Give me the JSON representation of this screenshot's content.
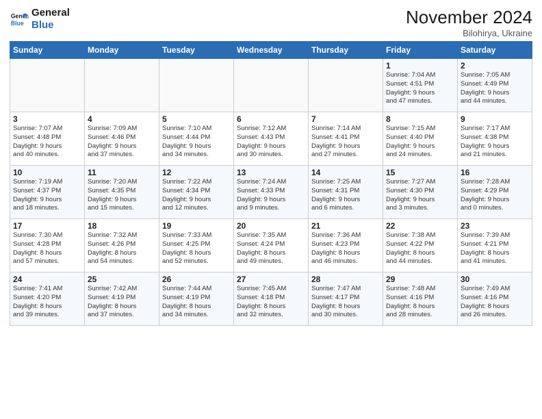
{
  "logo": {
    "line1": "General",
    "line2": "Blue"
  },
  "header": {
    "month": "November 2024",
    "location": "Bilohirya, Ukraine"
  },
  "weekdays": [
    "Sunday",
    "Monday",
    "Tuesday",
    "Wednesday",
    "Thursday",
    "Friday",
    "Saturday"
  ],
  "weeks": [
    [
      {
        "day": "",
        "info": ""
      },
      {
        "day": "",
        "info": ""
      },
      {
        "day": "",
        "info": ""
      },
      {
        "day": "",
        "info": ""
      },
      {
        "day": "",
        "info": ""
      },
      {
        "day": "1",
        "info": "Sunrise: 7:04 AM\nSunset: 4:51 PM\nDaylight: 9 hours\nand 47 minutes."
      },
      {
        "day": "2",
        "info": "Sunrise: 7:05 AM\nSunset: 4:49 PM\nDaylight: 9 hours\nand 44 minutes."
      }
    ],
    [
      {
        "day": "3",
        "info": "Sunrise: 7:07 AM\nSunset: 4:48 PM\nDaylight: 9 hours\nand 40 minutes."
      },
      {
        "day": "4",
        "info": "Sunrise: 7:09 AM\nSunset: 4:46 PM\nDaylight: 9 hours\nand 37 minutes."
      },
      {
        "day": "5",
        "info": "Sunrise: 7:10 AM\nSunset: 4:44 PM\nDaylight: 9 hours\nand 34 minutes."
      },
      {
        "day": "6",
        "info": "Sunrise: 7:12 AM\nSunset: 4:43 PM\nDaylight: 9 hours\nand 30 minutes."
      },
      {
        "day": "7",
        "info": "Sunrise: 7:14 AM\nSunset: 4:41 PM\nDaylight: 9 hours\nand 27 minutes."
      },
      {
        "day": "8",
        "info": "Sunrise: 7:15 AM\nSunset: 4:40 PM\nDaylight: 9 hours\nand 24 minutes."
      },
      {
        "day": "9",
        "info": "Sunrise: 7:17 AM\nSunset: 4:38 PM\nDaylight: 9 hours\nand 21 minutes."
      }
    ],
    [
      {
        "day": "10",
        "info": "Sunrise: 7:19 AM\nSunset: 4:37 PM\nDaylight: 9 hours\nand 18 minutes."
      },
      {
        "day": "11",
        "info": "Sunrise: 7:20 AM\nSunset: 4:35 PM\nDaylight: 9 hours\nand 15 minutes."
      },
      {
        "day": "12",
        "info": "Sunrise: 7:22 AM\nSunset: 4:34 PM\nDaylight: 9 hours\nand 12 minutes."
      },
      {
        "day": "13",
        "info": "Sunrise: 7:24 AM\nSunset: 4:33 PM\nDaylight: 9 hours\nand 9 minutes."
      },
      {
        "day": "14",
        "info": "Sunrise: 7:25 AM\nSunset: 4:31 PM\nDaylight: 9 hours\nand 6 minutes."
      },
      {
        "day": "15",
        "info": "Sunrise: 7:27 AM\nSunset: 4:30 PM\nDaylight: 9 hours\nand 3 minutes."
      },
      {
        "day": "16",
        "info": "Sunrise: 7:28 AM\nSunset: 4:29 PM\nDaylight: 9 hours\nand 0 minutes."
      }
    ],
    [
      {
        "day": "17",
        "info": "Sunrise: 7:30 AM\nSunset: 4:28 PM\nDaylight: 8 hours\nand 57 minutes."
      },
      {
        "day": "18",
        "info": "Sunrise: 7:32 AM\nSunset: 4:26 PM\nDaylight: 8 hours\nand 54 minutes."
      },
      {
        "day": "19",
        "info": "Sunrise: 7:33 AM\nSunset: 4:25 PM\nDaylight: 8 hours\nand 52 minutes."
      },
      {
        "day": "20",
        "info": "Sunrise: 7:35 AM\nSunset: 4:24 PM\nDaylight: 8 hours\nand 49 minutes."
      },
      {
        "day": "21",
        "info": "Sunrise: 7:36 AM\nSunset: 4:23 PM\nDaylight: 8 hours\nand 46 minutes."
      },
      {
        "day": "22",
        "info": "Sunrise: 7:38 AM\nSunset: 4:22 PM\nDaylight: 8 hours\nand 44 minutes."
      },
      {
        "day": "23",
        "info": "Sunrise: 7:39 AM\nSunset: 4:21 PM\nDaylight: 8 hours\nand 41 minutes."
      }
    ],
    [
      {
        "day": "24",
        "info": "Sunrise: 7:41 AM\nSunset: 4:20 PM\nDaylight: 8 hours\nand 39 minutes."
      },
      {
        "day": "25",
        "info": "Sunrise: 7:42 AM\nSunset: 4:19 PM\nDaylight: 8 hours\nand 37 minutes."
      },
      {
        "day": "26",
        "info": "Sunrise: 7:44 AM\nSunset: 4:19 PM\nDaylight: 8 hours\nand 34 minutes."
      },
      {
        "day": "27",
        "info": "Sunrise: 7:45 AM\nSunset: 4:18 PM\nDaylight: 8 hours\nand 32 minutes."
      },
      {
        "day": "28",
        "info": "Sunrise: 7:47 AM\nSunset: 4:17 PM\nDaylight: 8 hours\nand 30 minutes."
      },
      {
        "day": "29",
        "info": "Sunrise: 7:48 AM\nSunset: 4:16 PM\nDaylight: 8 hours\nand 28 minutes."
      },
      {
        "day": "30",
        "info": "Sunrise: 7:49 AM\nSunset: 4:16 PM\nDaylight: 8 hours\nand 26 minutes."
      }
    ]
  ]
}
